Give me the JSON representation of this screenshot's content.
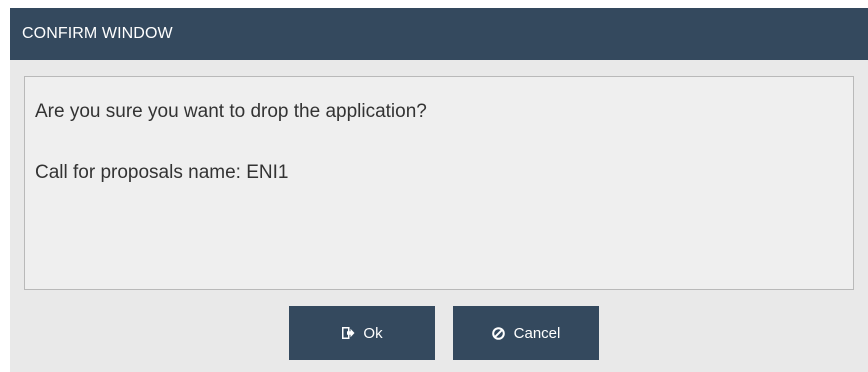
{
  "dialog": {
    "title": "CONFIRM WINDOW",
    "message_line1": "Are you sure you want to drop the application?",
    "message_line2": "Call for proposals name: ENI1",
    "buttons": {
      "ok": {
        "label": "Ok",
        "icon": "sign-out-icon"
      },
      "cancel": {
        "label": "Cancel",
        "icon": "ban-icon"
      }
    }
  },
  "colors": {
    "titlebar": "#34495e",
    "button": "#34495e",
    "background": "#e9e9e9",
    "message_box": "#efefef",
    "text": "#333333"
  }
}
